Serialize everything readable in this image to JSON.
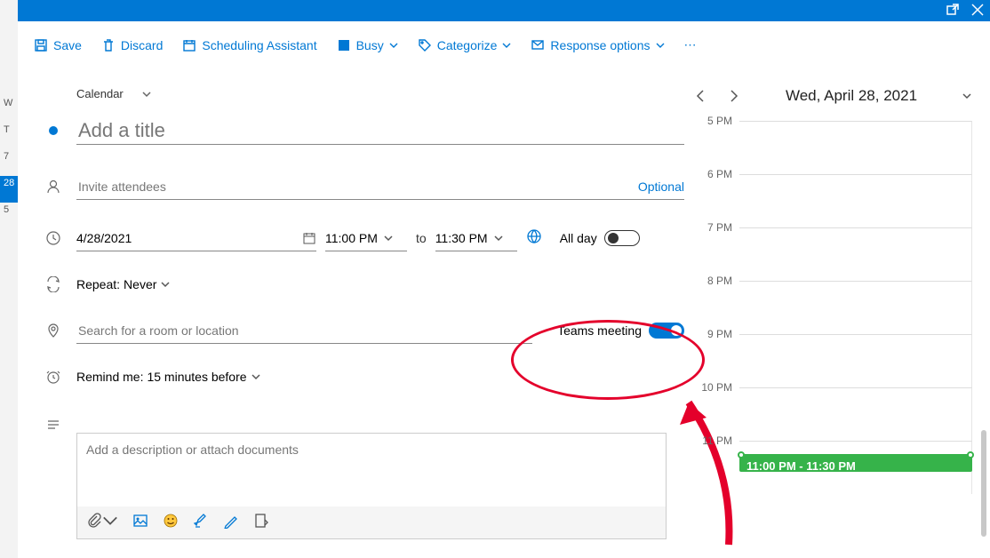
{
  "toolbar": {
    "save": "Save",
    "discard": "Discard",
    "scheduling": "Scheduling Assistant",
    "busy": "Busy",
    "categorize": "Categorize",
    "response": "Response options"
  },
  "crumb": "Calendar",
  "title_placeholder": "Add a title",
  "attendees_placeholder": "Invite attendees",
  "optional_label": "Optional",
  "date_value": "4/28/2021",
  "start_time": "11:00 PM",
  "to_label": "to",
  "end_time": "11:30 PM",
  "all_day_label": "All day",
  "repeat_label": "Repeat:",
  "repeat_value": "Never",
  "location_placeholder": "Search for a room or location",
  "teams_label": "Teams meeting",
  "remind_label": "Remind me:",
  "remind_value": "15 minutes before",
  "description_placeholder": "Add a description or attach documents",
  "side_date": "Wed, April 28, 2021",
  "hours": [
    "5 PM",
    "6 PM",
    "7 PM",
    "8 PM",
    "9 PM",
    "10 PM",
    "11 PM"
  ],
  "event_text": "11:00 PM - 11:30 PM"
}
